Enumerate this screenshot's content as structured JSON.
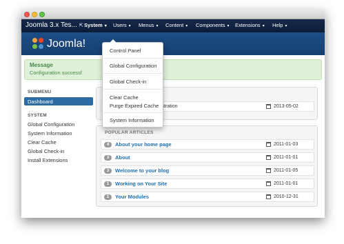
{
  "window": {
    "traffic_lights": [
      "close",
      "minimize",
      "zoom"
    ]
  },
  "navbar": {
    "brand": "Joomla 3.x Tes...",
    "brand_icon": "external-link-icon",
    "menus": [
      {
        "label": "System",
        "caret": "▾",
        "active": true
      },
      {
        "label": "Users",
        "caret": "▾"
      },
      {
        "label": "Menus",
        "caret": "▾"
      },
      {
        "label": "Content",
        "caret": "▾"
      },
      {
        "label": "Components",
        "caret": "▾"
      },
      {
        "label": "Extensions",
        "caret": "▾"
      },
      {
        "label": "Help",
        "caret": "▾"
      }
    ]
  },
  "header": {
    "logo_text": "Joomla!"
  },
  "dropdown": {
    "items": [
      "Control Panel",
      "Global Configuration",
      "Global Check-in",
      "Clear Cache",
      "Purge Expired Cache",
      "System Information"
    ]
  },
  "message": {
    "title": "Message",
    "text": "Configuration successf"
  },
  "sidebar": {
    "submenu_heading": "SUBMENU",
    "active_item": "Dashboard",
    "system_heading": "SYSTEM",
    "system_items": [
      "Global Configuration",
      "System Information",
      "Clear Cache",
      "Global Check-in",
      "Install Extensions"
    ]
  },
  "logged_panel": {
    "title_partial": "S",
    "row_text": "istration",
    "row_date": "2013-05-02"
  },
  "popular_panel": {
    "title": "POPULAR ARTICLES",
    "rows": [
      {
        "hits": "4",
        "title": "About your home page",
        "date": "2011-01-03"
      },
      {
        "hits": "3",
        "title": "About",
        "date": "2011-01-01"
      },
      {
        "hits": "3",
        "title": "Welcome to your blog",
        "date": "2011-01-05"
      },
      {
        "hits": "1",
        "title": "Working on Your Site",
        "date": "2011-01-01"
      },
      {
        "hits": "1",
        "title": "Your Modules",
        "date": "2010-12-31"
      }
    ]
  },
  "colors": {
    "navbar": "#0d1d38",
    "header": "#1d4e86",
    "active": "#2d6ca2",
    "link": "#1f6fb2",
    "success_bg": "#dff0d8",
    "success_text": "#468847"
  }
}
